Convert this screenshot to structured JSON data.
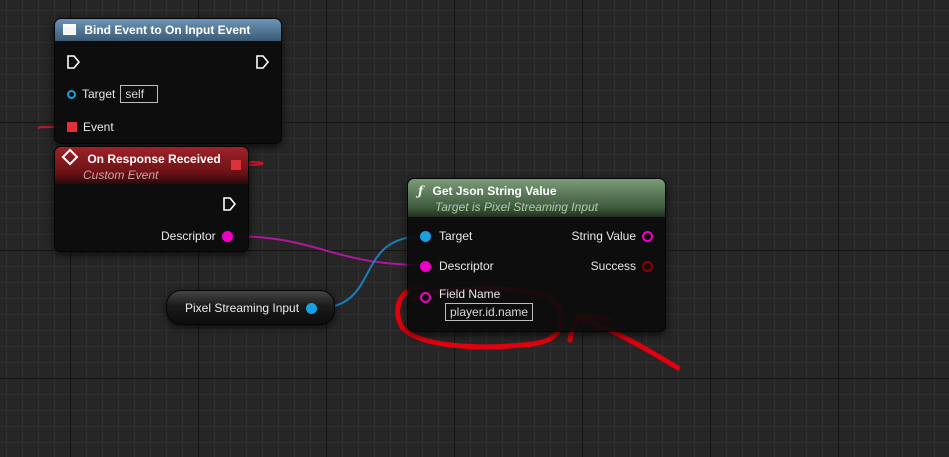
{
  "nodes": {
    "bind_event": {
      "title": "Bind Event to On Input Event",
      "icon": "window-icon",
      "header_color": "#5d86a8",
      "target_label": "Target",
      "target_value": "self",
      "event_label": "Event"
    },
    "custom_event": {
      "title": "On Response Received",
      "subtitle": "Custom Event",
      "icon": "event-diamond-icon",
      "header_color": "#8c1d22",
      "descriptor_label": "Descriptor"
    },
    "get_json": {
      "title": "Get Json String Value",
      "subtitle": "Target is Pixel Streaming Input",
      "icon": "function-icon",
      "icon_glyph": "ƒ",
      "header_color": "#5f7f5f",
      "target_label": "Target",
      "descriptor_label": "Descriptor",
      "field_name_label": "Field Name",
      "field_name_value": "player.id.name",
      "string_value_label": "String Value",
      "success_label": "Success"
    },
    "pixel_streaming_input": {
      "label": "Pixel Streaming Input"
    }
  },
  "colors": {
    "object_pin": "#1a9fe0",
    "struct_pin": "#ee00c8",
    "string_pin": "#ee00c8",
    "bool_pin": "#8b0000",
    "delegate_pin": "#e0303c",
    "annotation": "#e0000e"
  }
}
